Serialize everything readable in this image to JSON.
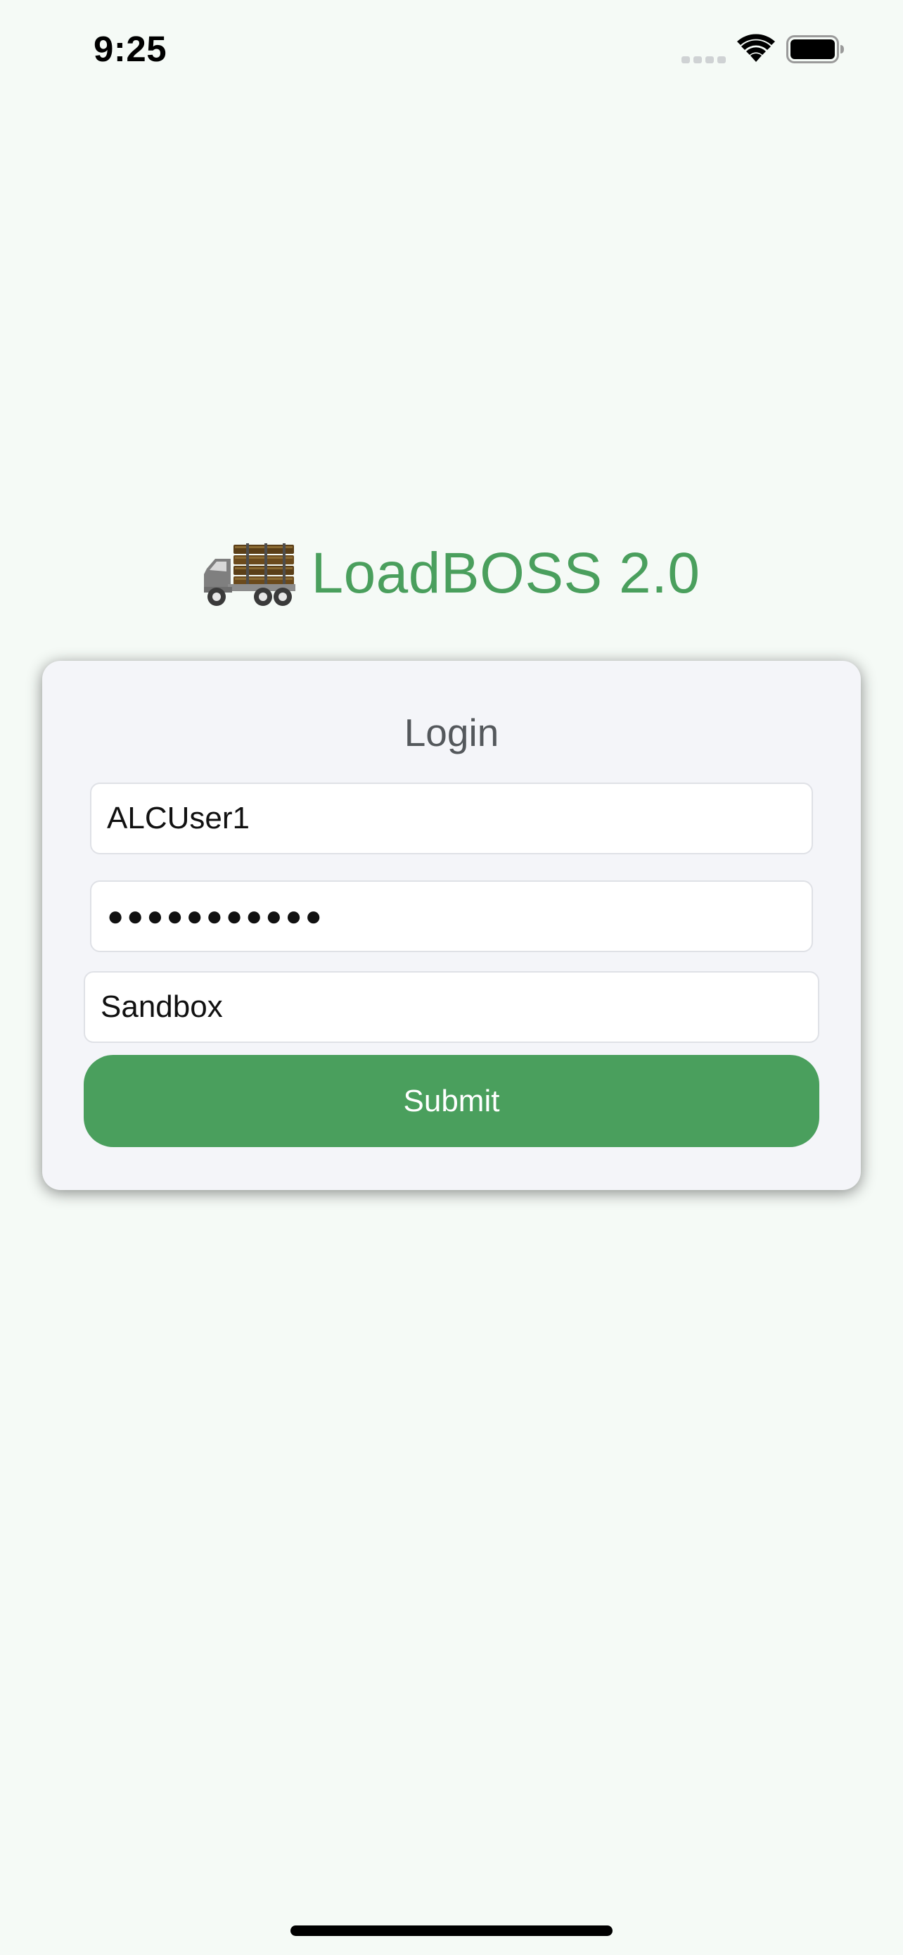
{
  "status_bar": {
    "time": "9:25"
  },
  "app": {
    "title": "LoadBOSS 2.0",
    "logo_icon": "logging-truck-icon",
    "accent_color": "#4a9f5d"
  },
  "login": {
    "heading": "Login",
    "username_value": "ALCUser1",
    "password_value": "●●●●●●●●●●●",
    "environment_value": "Sandbox",
    "submit_label": "Submit"
  }
}
